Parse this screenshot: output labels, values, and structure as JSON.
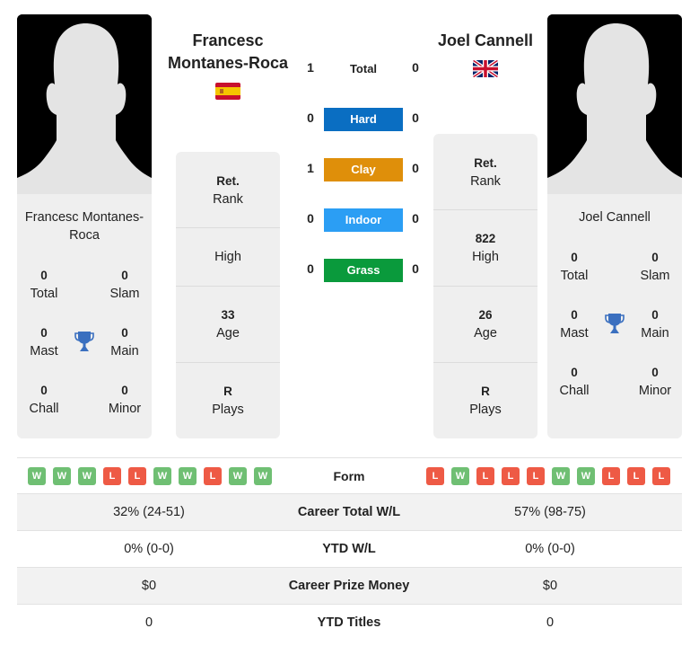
{
  "colors": {
    "hard": "#0a6ec2",
    "clay": "#df8f0a",
    "indoor": "#2b9ef4",
    "grass": "#0a9a3c",
    "win": "#6fbf73",
    "loss": "#ee5a45",
    "trophy": "#3a6fbf"
  },
  "player1": {
    "name": "Francesc Montanes-Roca",
    "name_line1": "Francesc",
    "name_line2": "Montanes-Roca",
    "card_name_line1": "Francesc Montanes-",
    "card_name_line2": "Roca",
    "flag": "spain-flag",
    "titles": {
      "total": {
        "value": "0",
        "label": "Total"
      },
      "slam": {
        "value": "0",
        "label": "Slam"
      },
      "mast": {
        "value": "0",
        "label": "Mast"
      },
      "main": {
        "value": "0",
        "label": "Main"
      },
      "chall": {
        "value": "0",
        "label": "Chall"
      },
      "minor": {
        "value": "0",
        "label": "Minor"
      }
    },
    "info": {
      "rank": {
        "value": "Ret.",
        "label": "Rank"
      },
      "high": {
        "value": "",
        "label": "High"
      },
      "age": {
        "value": "33",
        "label": "Age"
      },
      "plays": {
        "value": "R",
        "label": "Plays"
      }
    },
    "form": [
      "W",
      "W",
      "W",
      "L",
      "L",
      "W",
      "W",
      "L",
      "W",
      "W"
    ]
  },
  "player2": {
    "name": "Joel Cannell",
    "card_name": "Joel Cannell",
    "flag": "uk-flag",
    "titles": {
      "total": {
        "value": "0",
        "label": "Total"
      },
      "slam": {
        "value": "0",
        "label": "Slam"
      },
      "mast": {
        "value": "0",
        "label": "Mast"
      },
      "main": {
        "value": "0",
        "label": "Main"
      },
      "chall": {
        "value": "0",
        "label": "Chall"
      },
      "minor": {
        "value": "0",
        "label": "Minor"
      }
    },
    "info": {
      "rank": {
        "value": "Ret.",
        "label": "Rank"
      },
      "high": {
        "value": "822",
        "label": "High"
      },
      "age": {
        "value": "26",
        "label": "Age"
      },
      "plays": {
        "value": "R",
        "label": "Plays"
      }
    },
    "form": [
      "L",
      "W",
      "L",
      "L",
      "L",
      "W",
      "W",
      "L",
      "L",
      "L"
    ]
  },
  "h2h": {
    "total": {
      "label": "Total",
      "p1": "1",
      "p2": "0"
    },
    "surfaces": [
      {
        "key": "hard",
        "label": "Hard",
        "p1": "0",
        "p2": "0"
      },
      {
        "key": "clay",
        "label": "Clay",
        "p1": "1",
        "p2": "0"
      },
      {
        "key": "indoor",
        "label": "Indoor",
        "p1": "0",
        "p2": "0"
      },
      {
        "key": "grass",
        "label": "Grass",
        "p1": "0",
        "p2": "0"
      }
    ]
  },
  "form_label": "Form",
  "stats": [
    {
      "label": "Career Total W/L",
      "p1": "32% (24-51)",
      "p2": "57% (98-75)"
    },
    {
      "label": "YTD W/L",
      "p1": "0% (0-0)",
      "p2": "0% (0-0)"
    },
    {
      "label": "Career Prize Money",
      "p1": "$0",
      "p2": "$0"
    },
    {
      "label": "YTD Titles",
      "p1": "0",
      "p2": "0"
    }
  ]
}
